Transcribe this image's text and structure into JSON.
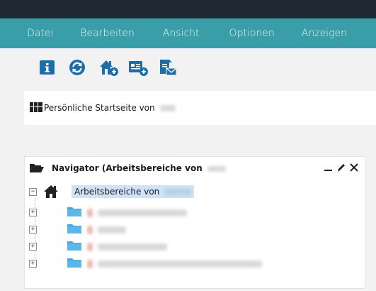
{
  "menu": {
    "items": [
      "Datei",
      "Bearbeiten",
      "Ansicht",
      "Optionen",
      "Anzeigen"
    ]
  },
  "toolbar": {
    "buttons": [
      "info-icon",
      "refresh-icon",
      "home-add-icon",
      "dashboard-add-icon",
      "document-mail-icon"
    ]
  },
  "home_panel": {
    "title": "Persönliche Startseite von"
  },
  "navigator": {
    "title": "Navigator (Arbeitsbereiche von",
    "root_label": "Arbeitsbereiche von",
    "children_count_visible": 4
  },
  "colors": {
    "accent": "#3a9ea8",
    "topbar": "#1f2933",
    "selection": "#cfe3f7",
    "folder": "#49a7de"
  }
}
